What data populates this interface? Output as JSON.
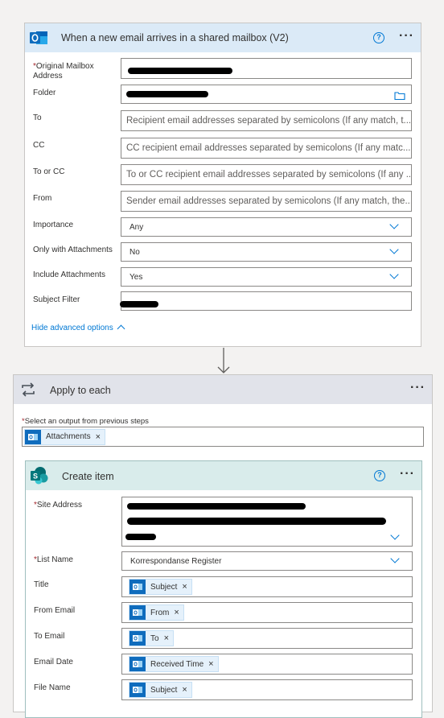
{
  "trigger": {
    "title": "When a new email arrives in a shared mailbox (V2)",
    "icon": "outlook-icon",
    "fields": {
      "mailbox_label": "Original Mailbox Address",
      "folder_label": "Folder",
      "to_label": "To",
      "to_placeholder": "Recipient email addresses separated by semicolons (If any match, t...",
      "cc_label": "CC",
      "cc_placeholder": "CC recipient email addresses separated by semicolons (If any matc...",
      "toorcc_label": "To or CC",
      "toorcc_placeholder": "To or CC recipient email addresses separated by semicolons (If any ...",
      "from_label": "From",
      "from_placeholder": "Sender email addresses separated by semicolons (If any match, the...",
      "importance_label": "Importance",
      "importance_value": "Any",
      "attachments_only_label": "Only with Attachments",
      "attachments_only_value": "No",
      "include_attachments_label": "Include Attachments",
      "include_attachments_value": "Yes",
      "subject_filter_label": "Subject Filter"
    },
    "hide_advanced": "Hide advanced options"
  },
  "apply_each": {
    "title": "Apply to each",
    "select_label": "Select an output from previous steps",
    "token": "Attachments"
  },
  "create_item": {
    "title": "Create item",
    "fields": {
      "site_label": "Site Address",
      "list_label": "List Name",
      "list_value": "Korrespondanse Register",
      "title_label": "Title",
      "title_token": "Subject",
      "from_email_label": "From Email",
      "from_email_token": "From",
      "to_email_label": "To Email",
      "to_email_token": "To",
      "email_date_label": "Email Date",
      "email_date_token": "Received Time",
      "file_name_label": "File Name",
      "file_name_token": "Subject"
    }
  },
  "colors": {
    "trigger_header": "#dbeaf7",
    "apply_header": "#e1e3ea",
    "create_header": "#d9eceb",
    "accent": "#0078d4",
    "outlook": "#0f6cbd",
    "sharepoint": "#038387"
  }
}
